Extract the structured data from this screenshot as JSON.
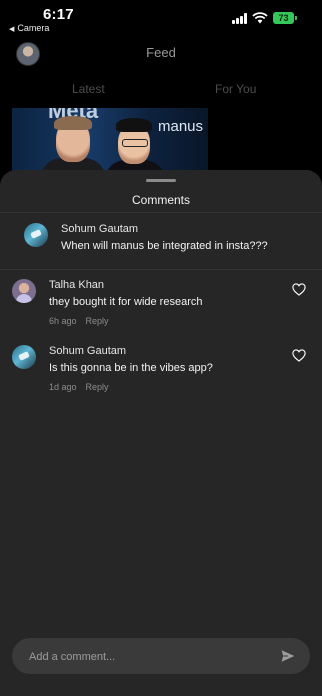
{
  "status_bar": {
    "time": "6:17",
    "back_app": "Camera",
    "battery": "73"
  },
  "header": {
    "title": "Feed",
    "tabs": [
      {
        "label": "Latest"
      },
      {
        "label": "For You"
      }
    ]
  },
  "post_image": {
    "words": [
      "Meta",
      "manus"
    ]
  },
  "comments_sheet": {
    "title": "Comments",
    "caption": {
      "author": "Sohum Gautam",
      "text": "When will manus be integrated in insta???"
    },
    "comments": [
      {
        "author": "Talha Khan",
        "text": "they bought it for wide research",
        "time": "6h ago",
        "reply_label": "Reply"
      },
      {
        "author": "Sohum Gautam",
        "text": "Is this gonna be in the vibes app?",
        "time": "1d ago",
        "reply_label": "Reply"
      }
    ],
    "input": {
      "placeholder": "Add a comment..."
    }
  },
  "colors": {
    "sheet_bg": "#262626",
    "input_bg": "#3a3a3a",
    "battery": "#34c759"
  },
  "icons": [
    "back-triangle-icon",
    "signal-icon",
    "wifi-icon",
    "battery-icon",
    "heart-icon",
    "send-icon"
  ]
}
